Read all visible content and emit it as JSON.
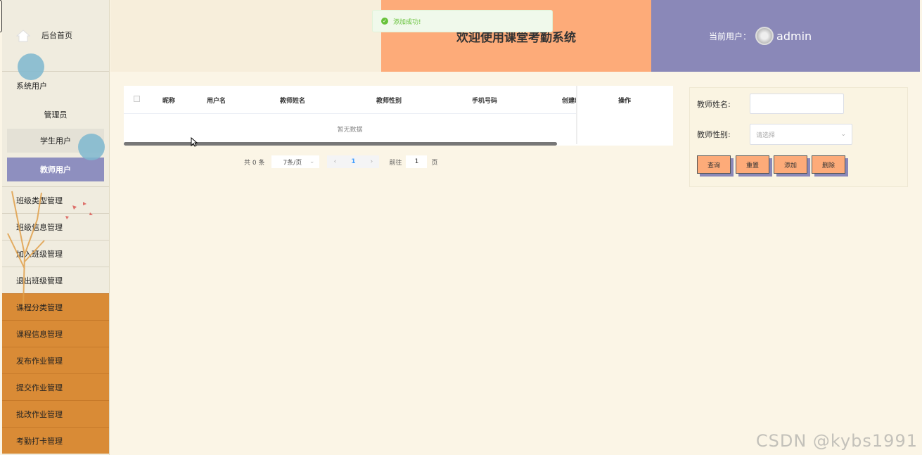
{
  "sidebar": {
    "home": "后台首页",
    "group_title": "系统用户",
    "sub_items": [
      "管理员",
      "学生用户",
      "教师用户"
    ],
    "items": [
      "班级类型管理",
      "班级信息管理",
      "加入班级管理",
      "退出班级管理"
    ],
    "orange_items": [
      "课程分类管理",
      "课程信息管理",
      "发布作业管理",
      "提交作业管理",
      "批改作业管理",
      "考勤打卡管理"
    ]
  },
  "header": {
    "welcome": "欢迎使用课堂考勤系统",
    "current_user_label": "当前用户：",
    "username": "admin"
  },
  "toast": {
    "message": "添加成功!"
  },
  "table": {
    "columns": [
      "昵称",
      "用户名",
      "教师姓名",
      "教师性别",
      "手机号码",
      "创建时"
    ],
    "op_column": "操作",
    "empty_text": "暂无数据"
  },
  "pager": {
    "total": "共 0 条",
    "page_size": "7条/页",
    "current_page": "1",
    "goto_label": "前往",
    "goto_value": "1",
    "page_suffix": "页"
  },
  "search": {
    "name_label": "教师姓名:",
    "gender_label": "教师性别:",
    "gender_placeholder": "请选择",
    "buttons": [
      "查询",
      "重置",
      "添加",
      "删除"
    ]
  },
  "watermark": "CSDN @kybs1991",
  "colors": {
    "accent_orange": "#fdab79",
    "accent_purple": "#8a88b8",
    "sidebar_orange": "#d98b36"
  }
}
